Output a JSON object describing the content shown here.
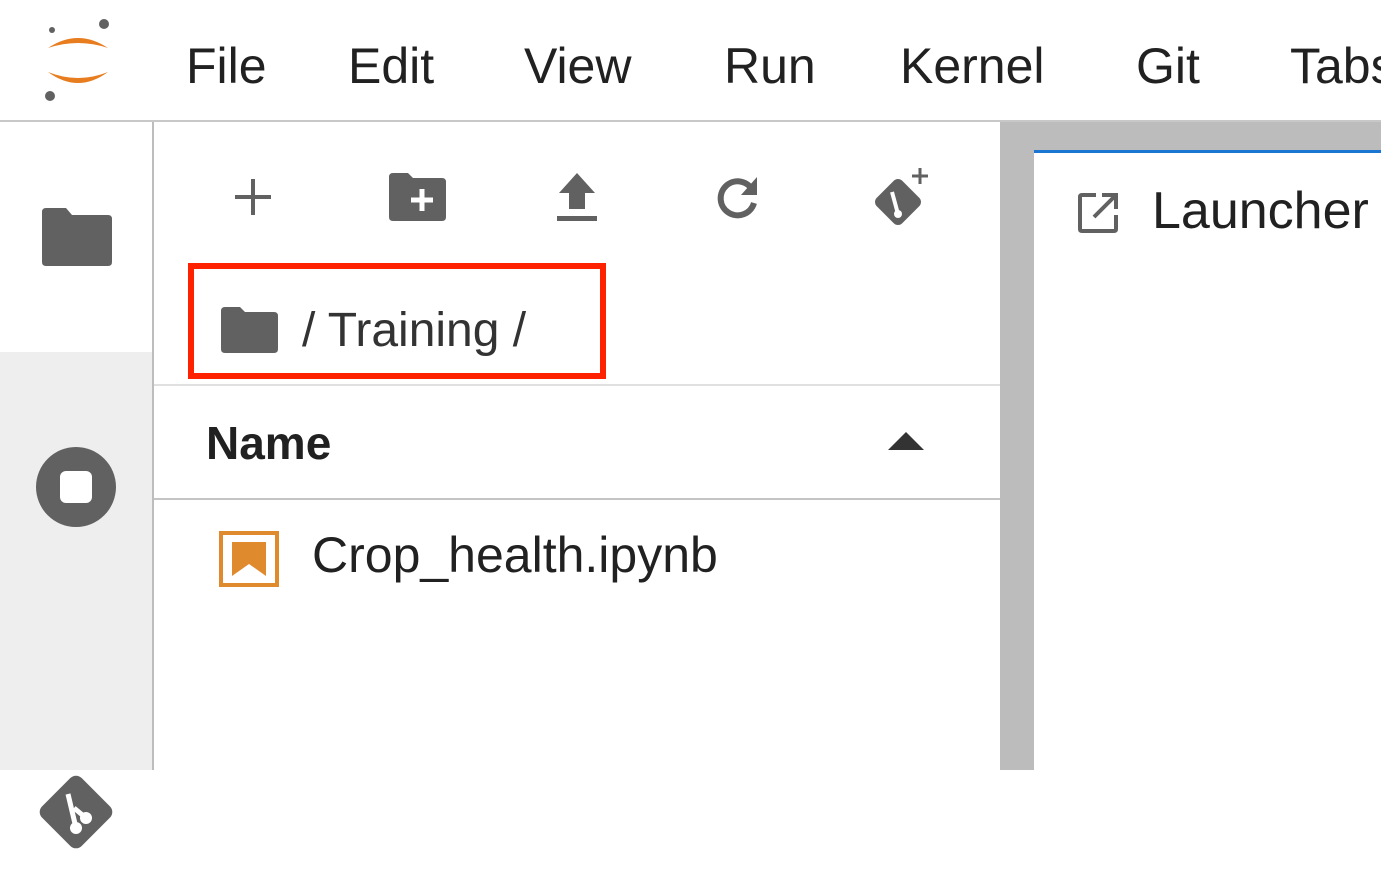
{
  "menubar": {
    "items": [
      "File",
      "Edit",
      "View",
      "Run",
      "Kernel",
      "Git",
      "Tabs"
    ]
  },
  "activity_bar": {
    "tabs": [
      "folder-icon",
      "running-icon",
      "git-icon"
    ]
  },
  "file_browser": {
    "toolbar": [
      "new-launcher-icon",
      "new-folder-icon",
      "upload-icon",
      "refresh-icon",
      "git-clone-icon"
    ],
    "breadcrumb": "/ Training /",
    "column_header": "Name",
    "files": [
      {
        "name": "Crop_health.ipynb",
        "icon": "notebook-icon"
      }
    ]
  },
  "main": {
    "tabs": [
      {
        "label": "Launcher",
        "icon": "launcher-icon"
      }
    ]
  },
  "colors": {
    "accent": "#1976d2",
    "highlight": "#ff2200",
    "notebook": "#e08a2e",
    "icon": "#616161"
  }
}
